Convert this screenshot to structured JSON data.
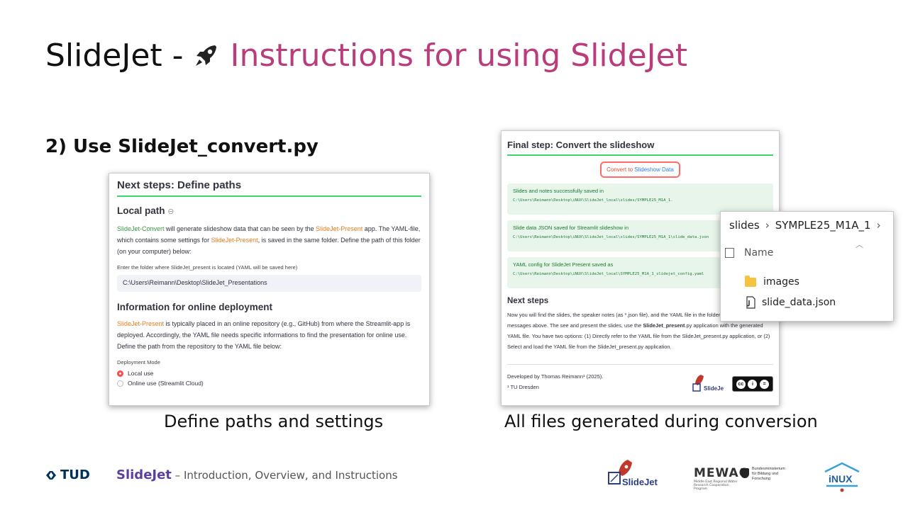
{
  "slide": {
    "title_black": "SlideJet - ",
    "title_pink": "Instructions for using SlideJet",
    "subheading": "2) Use SlideJet_convert.py",
    "caption_left": "Define paths and settings",
    "caption_right_bold": "All files generated",
    "caption_right_rest": " during  conversion"
  },
  "left_shot": {
    "header": "Next steps: Define paths",
    "local_path": "Local path",
    "para1_a": "SlideJet-Convert",
    "para1_b": " will generate slideshow data that can be seen by the ",
    "para1_c": "SlideJet-Present",
    "para1_d": " app. The YAML-file, which contains some settings for ",
    "para1_e": "SlideJet-Present",
    "para1_f": ", is saved in the same folder. Define the path of this folder (on your computer) below:",
    "input_label": "Enter the folder where SlideJet_present is located (YAML will be saved here)",
    "input_value": "C:\\Users\\Reimann\\Desktop\\SlideJet_Presentations",
    "online_header": "Information for online deployment",
    "para2_a": "SlideJet-Present",
    "para2_b": " is typically placed in an online repository (e.g., GitHub) from where the Streamlit-app is deployed. Accordingly, the YAML file needs specific informations to find the presentation for online use. Define the path from the repository to the YAML file below:",
    "mode_label": "Deployment Mode",
    "radio_local": "Local use",
    "radio_online": "Online use (Streamlit Cloud)"
  },
  "right_shot": {
    "header": "Final step: Convert the slideshow",
    "btn_a": "Convert to ",
    "btn_b": "Slideshow",
    "btn_c": " Data",
    "ok1_title": "Slides and notes successfully saved in",
    "ok1_path": "C:\\Users\\Reimann\\Desktop\\iNUX\\SlideJet_local\\slides/SYMPLE25_M1A_1.",
    "ok2_title": "Slide data JSON saved for Streamlit slideshow in",
    "ok2_path": "C:\\Users\\Reimann\\Desktop\\iNUX\\SlideJet_local\\slides/SYMPLE25_M1A_1\\slide_data.json",
    "ok3_title": "YAML config for SlideJet Present saved as",
    "ok3_path": "C:\\Users\\Reimann\\Desktop\\iNUX\\SlideJet_local\\SYMPLE25_M1A_1_slidejet_config.yaml",
    "next_steps": "Next steps",
    "next_a": "Now you will find the slides, the speaker notes (as *.json file), and the YAML file in the folders listed in the see messages above. The see and present the slides, use the ",
    "next_b": "SlideJet_present",
    "next_c": ".py application with the generated YAML file. You have two options: (1) Directly refer to the YAML file from the SlideJet_present.py application, or (2) Select and load the YAML file from the SlideJet_present.py application.",
    "developed": "Developed by Thomas Reimann¹ (2025).",
    "affil": "¹ TU Dresden",
    "mini_logo": "SlideJet",
    "cc_parts": [
      "cc",
      "i",
      "="
    ]
  },
  "explorer": {
    "crumb1": "slides",
    "crumb2": "SYMPLE25_M1A_1",
    "col_name": "Name",
    "items": [
      {
        "name": "images",
        "icon": "folder-icon"
      },
      {
        "name": "slide_data.json",
        "icon": "json-file-icon"
      }
    ]
  },
  "footer": {
    "tud": "TUD",
    "brand": "SlideJet",
    "text": " – Introduction, Overview, and Instructions",
    "slidejet_logo": "SlideJet",
    "mewac": "MEWAC",
    "mewac_sub": "Middle East Regional Water Research Cooperation Program",
    "bmbf": "Bundesministerium für Bildung und Forschung",
    "inux": "iNUX"
  },
  "colors": {
    "pink": "#b83d7a",
    "accent_green": "#3dd56d",
    "tud_blue": "#00305d"
  }
}
